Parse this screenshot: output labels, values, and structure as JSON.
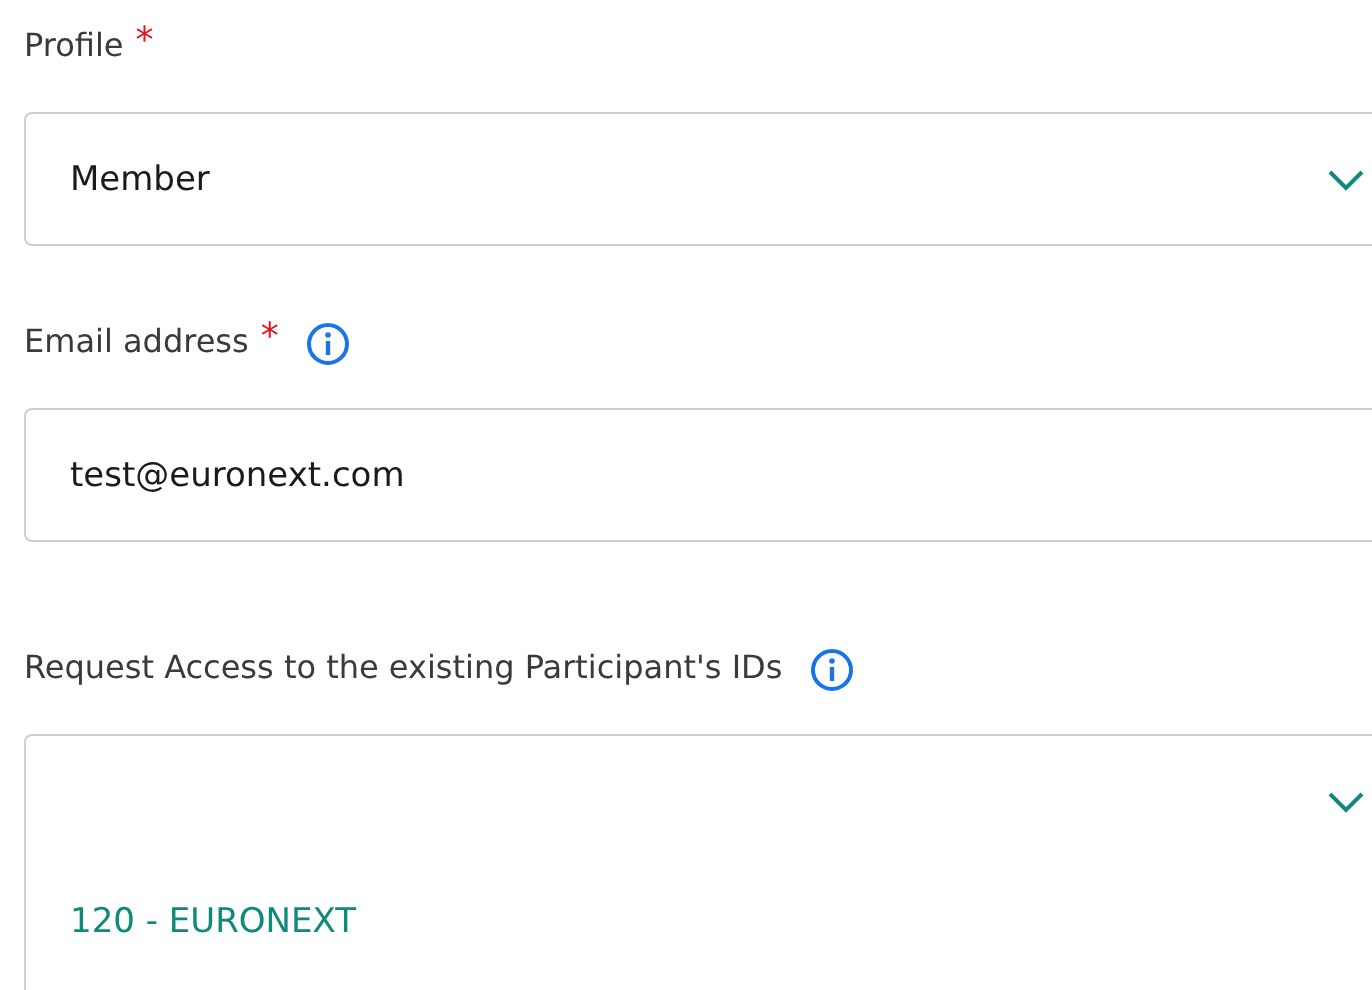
{
  "fields": [
    {
      "kind": "select",
      "label": "Profile",
      "required_mark": "*",
      "info": false,
      "value": "Member"
    },
    {
      "kind": "text",
      "label": "Email address",
      "required_mark": "*",
      "info": true,
      "value": "test@euronext.com"
    },
    {
      "kind": "select",
      "label": "Request Access to the existing Participant's IDs",
      "info": true,
      "expanded": true,
      "options": [
        "120 - EURONEXT"
      ]
    }
  ]
}
